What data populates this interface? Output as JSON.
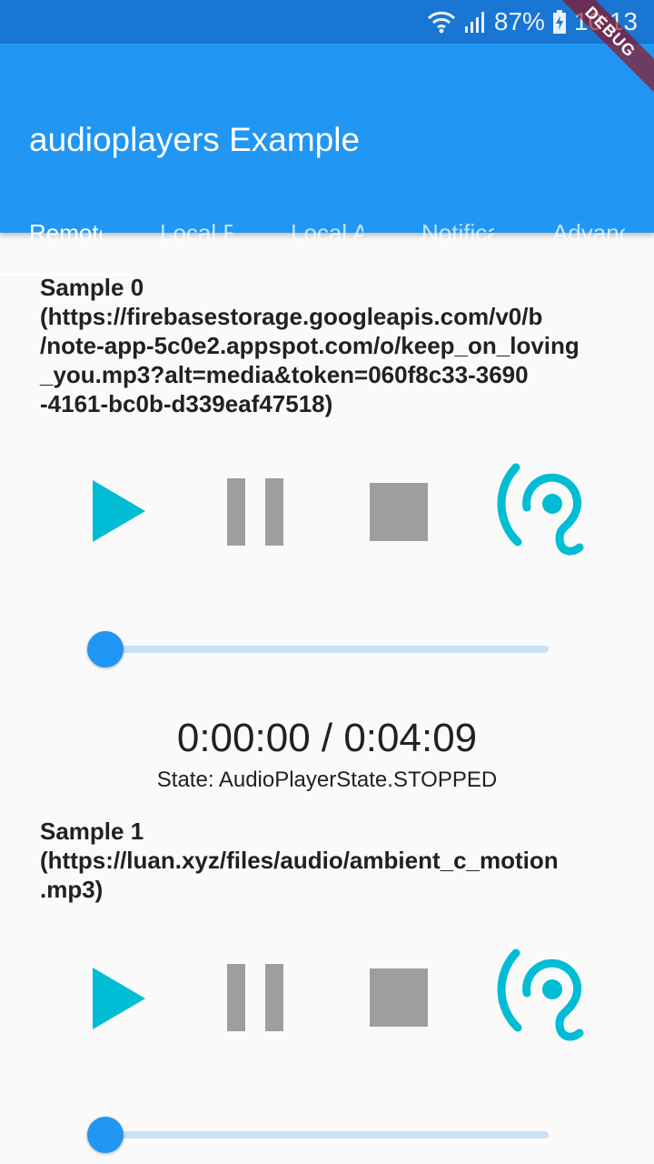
{
  "status_bar": {
    "battery": "87%",
    "time": "10:13"
  },
  "debug_banner": "DEBUG",
  "app_bar": {
    "title": "audioplayers Example"
  },
  "tabs": [
    {
      "label": "Remote URL"
    },
    {
      "label": "Local File"
    },
    {
      "label": "Local Asset"
    },
    {
      "label": "Notification"
    },
    {
      "label": "Advanced"
    }
  ],
  "samples": [
    {
      "title": "Sample 0\n(https://firebasestorage.googleapis.com/v0/b\n/note-app-5c0e2.appspot.com/o/keep_on_loving\n_you.mp3?alt=media&token=060f8c33-3690\n-4161-bc0b-d339eaf47518)",
      "position_fraction": 0,
      "time": "0:00:00 / 0:04:09",
      "state": "State: AudioPlayerState.STOPPED"
    },
    {
      "title": "Sample 1\n(https://luan.xyz/files/audio/ambient_c_motion\n.mp3)",
      "position_fraction": 0
    }
  ],
  "icons": {
    "play": "play-icon",
    "pause": "pause-icon",
    "stop": "stop-icon",
    "ear": "hearing-icon"
  },
  "colors": {
    "status_bar": "#1976d2",
    "app_bar": "#2196f3",
    "accent_cyan": "#00bcd4",
    "disabled_grey": "#9e9e9e",
    "slider_active": "#2196f3",
    "slider_inactive": "#c8e1f8"
  }
}
